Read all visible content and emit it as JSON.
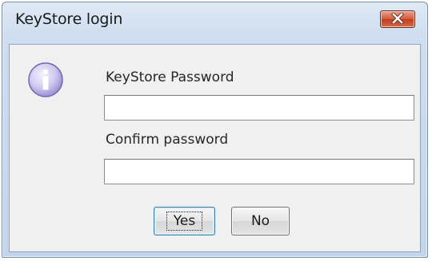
{
  "dialog": {
    "title": "KeyStore login",
    "close_icon": "close-icon",
    "info_icon": "info-icon",
    "fields": [
      {
        "label": "KeyStore Password",
        "value": ""
      },
      {
        "label": "Confirm password",
        "value": ""
      }
    ],
    "buttons": {
      "yes_label": "Yes",
      "no_label": "No"
    },
    "colors": {
      "title_bar": "#cfdeef",
      "close_button": "#c9472a",
      "client_background": "#f0f0f0",
      "default_button_border": "#3c7fb1"
    }
  }
}
